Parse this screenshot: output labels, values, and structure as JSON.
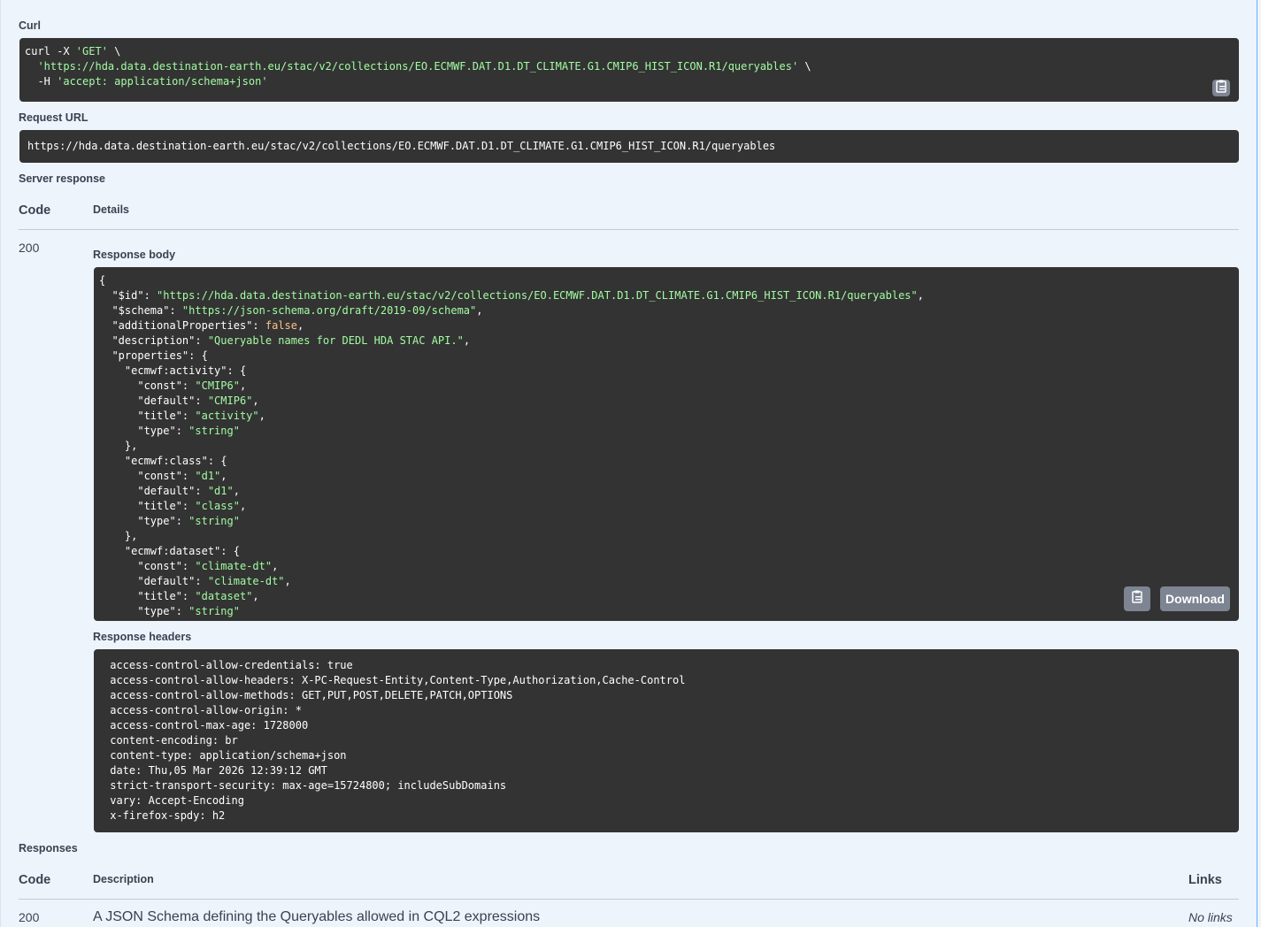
{
  "curl": {
    "label": "Curl",
    "lines": [
      {
        "plain": "curl -X ",
        "str": "'GET'",
        "tail": " \\"
      },
      {
        "plain": "  ",
        "str": "'https://hda.data.destination-earth.eu/stac/v2/collections/EO.ECMWF.DAT.D1.DT_CLIMATE.G1.CMIP6_HIST_ICON.R1/queryables'",
        "tail": " \\"
      },
      {
        "plain": "  -H ",
        "str": "'accept: application/schema+json'",
        "tail": ""
      }
    ],
    "copy_icon": "clipboard-icon"
  },
  "request_url": {
    "label": "Request URL",
    "value": "https://hda.data.destination-earth.eu/stac/v2/collections/EO.ECMWF.DAT.D1.DT_CLIMATE.G1.CMIP6_HIST_ICON.R1/queryables"
  },
  "server_response": {
    "label": "Server response",
    "col_code": "Code",
    "col_details": "Details",
    "code": "200",
    "body_label": "Response body",
    "body_lines": [
      [
        [
          "p",
          "{"
        ]
      ],
      [
        [
          "p",
          "  \"$id\": "
        ],
        [
          "s",
          "\"https://hda.data.destination-earth.eu/stac/v2/collections/EO.ECMWF.DAT.D1.DT_CLIMATE.G1.CMIP6_HIST_ICON.R1/queryables\""
        ],
        [
          "p",
          ","
        ]
      ],
      [
        [
          "p",
          "  \"$schema\": "
        ],
        [
          "s",
          "\"https://json-schema.org/draft/2019-09/schema\""
        ],
        [
          "p",
          ","
        ]
      ],
      [
        [
          "p",
          "  \"additionalProperties\": "
        ],
        [
          "b",
          "false"
        ],
        [
          "p",
          ","
        ]
      ],
      [
        [
          "p",
          "  \"description\": "
        ],
        [
          "s",
          "\"Queryable names for DEDL HDA STAC API.\""
        ],
        [
          "p",
          ","
        ]
      ],
      [
        [
          "p",
          "  \"properties\": {"
        ]
      ],
      [
        [
          "p",
          "    \"ecmwf:activity\": {"
        ]
      ],
      [
        [
          "p",
          "      \"const\": "
        ],
        [
          "s",
          "\"CMIP6\""
        ],
        [
          "p",
          ","
        ]
      ],
      [
        [
          "p",
          "      \"default\": "
        ],
        [
          "s",
          "\"CMIP6\""
        ],
        [
          "p",
          ","
        ]
      ],
      [
        [
          "p",
          "      \"title\": "
        ],
        [
          "s",
          "\"activity\""
        ],
        [
          "p",
          ","
        ]
      ],
      [
        [
          "p",
          "      \"type\": "
        ],
        [
          "s",
          "\"string\""
        ]
      ],
      [
        [
          "p",
          "    },"
        ]
      ],
      [
        [
          "p",
          "    \"ecmwf:class\": {"
        ]
      ],
      [
        [
          "p",
          "      \"const\": "
        ],
        [
          "s",
          "\"d1\""
        ],
        [
          "p",
          ","
        ]
      ],
      [
        [
          "p",
          "      \"default\": "
        ],
        [
          "s",
          "\"d1\""
        ],
        [
          "p",
          ","
        ]
      ],
      [
        [
          "p",
          "      \"title\": "
        ],
        [
          "s",
          "\"class\""
        ],
        [
          "p",
          ","
        ]
      ],
      [
        [
          "p",
          "      \"type\": "
        ],
        [
          "s",
          "\"string\""
        ]
      ],
      [
        [
          "p",
          "    },"
        ]
      ],
      [
        [
          "p",
          "    \"ecmwf:dataset\": {"
        ]
      ],
      [
        [
          "p",
          "      \"const\": "
        ],
        [
          "s",
          "\"climate-dt\""
        ],
        [
          "p",
          ","
        ]
      ],
      [
        [
          "p",
          "      \"default\": "
        ],
        [
          "s",
          "\"climate-dt\""
        ],
        [
          "p",
          ","
        ]
      ],
      [
        [
          "p",
          "      \"title\": "
        ],
        [
          "s",
          "\"dataset\""
        ],
        [
          "p",
          ","
        ]
      ],
      [
        [
          "p",
          "      \"type\": "
        ],
        [
          "s",
          "\"string\""
        ]
      ]
    ],
    "copy_icon": "clipboard-icon",
    "download_label": "Download",
    "headers_label": "Response headers",
    "headers_lines": [
      " access-control-allow-credentials: true ",
      " access-control-allow-headers: X-PC-Request-Entity,Content-Type,Authorization,Cache-Control ",
      " access-control-allow-methods: GET,PUT,POST,DELETE,PATCH,OPTIONS ",
      " access-control-allow-origin: * ",
      " access-control-max-age: 1728000 ",
      " content-encoding: br ",
      " content-type: application/schema+json ",
      " date: Thu,05 Mar 2026 12:39:12 GMT ",
      " strict-transport-security: max-age=15724800; includeSubDomains ",
      " vary: Accept-Encoding ",
      " x-firefox-spdy: h2 "
    ]
  },
  "responses": {
    "label": "Responses",
    "col_code": "Code",
    "col_description": "Description",
    "col_links": "Links",
    "rows": [
      {
        "code": "200",
        "description": "A JSON Schema defining the Queryables allowed in CQL2 expressions",
        "links": "No links"
      }
    ]
  },
  "colors": {
    "code_bg": "#333333",
    "string": "#a2fca2",
    "boolean": "#fcc28c",
    "panel_bg": "#eef4fb",
    "button_bg": "#7d8492"
  }
}
